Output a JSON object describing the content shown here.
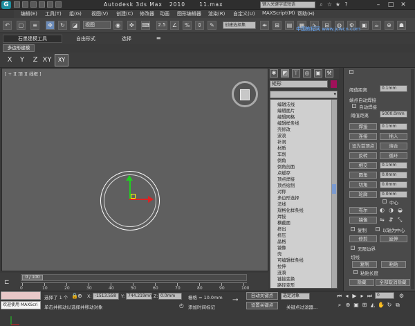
{
  "app": {
    "title": "Autodesk 3ds Max   2010      11.max",
    "search_placeholder": "键入关键字或短语",
    "logo": "3ds-max-logo"
  },
  "menu": [
    "编辑(E)",
    "工具(T)",
    "组(G)",
    "视图(V)",
    "创建(C)",
    "修改器",
    "动画",
    "图形编辑器",
    "渲染(R)",
    "自定义(U)",
    "MAXScript(M)",
    "帮助(H)"
  ],
  "toolbar": {
    "view_dropdown": "视图",
    "angle_snap": "2.5",
    "selection_set": "创建选择集"
  },
  "watermark": "中国教程网 www.jcwcn.com",
  "ribbon": {
    "tabs": [
      "石墨建模工具",
      "自由形式",
      "选择"
    ],
    "subtab": "多边形建模",
    "axes": [
      "X",
      "Y",
      "Z",
      "XY",
      "XY"
    ]
  },
  "viewport": {
    "label": "[ + ][ 顶 ][ 线框 ]"
  },
  "command_panel": {
    "object_name": "矩形",
    "object_color": "#a0105a",
    "modifiers": [
      "编辑法线",
      "编辑面片",
      "编辑网格",
      "编辑样条线",
      "壳修改",
      "波浪",
      "补洞",
      "材质",
      "车削",
      "倒角",
      "倒角剖面",
      "点缓存",
      "顶点焊接",
      "顶点绘制",
      "对称",
      "多边形选择",
      "法线",
      "规格化样条线",
      "焊接",
      "横截面",
      "挤出",
      "挤压",
      "晶格",
      "镜像",
      "壳",
      "可编辑样条线",
      "拉伸",
      "涟漪",
      "链接变换",
      "路径变形"
    ]
  },
  "rollout": {
    "threshold_label": "阈值距离",
    "threshold_value": "0.1mm",
    "auto_weld_group": "端点自动焊接",
    "auto_weld_chk": "自动焊接",
    "auto_weld_value": "5000.0mm",
    "buttons": [
      {
        "name": "weld",
        "label": "焊接",
        "value": "0.1mm"
      },
      {
        "name": "connect",
        "label": "连接",
        "value": "插入"
      },
      {
        "name": "make-first",
        "label": "设为首顶点",
        "value": "熔合"
      },
      {
        "name": "reverse",
        "label": "反转",
        "value": "循环"
      },
      {
        "name": "intersect",
        "label": "相交",
        "value": "0.1mm"
      },
      {
        "name": "fillet",
        "label": "圆角",
        "value": "0.0mm"
      },
      {
        "name": "chamfer",
        "label": "切角",
        "value": "0.0mm"
      },
      {
        "name": "outline",
        "label": "轮廓",
        "value": "0.0mm"
      }
    ],
    "center": "中心",
    "boolean": "布尔",
    "mirror": "镜像",
    "copy": "复制",
    "pivot": "以轴为中心",
    "trim": "修剪",
    "extend": "延伸",
    "infinite": "无限边界",
    "tangent_group": "切线",
    "tan_copy": "复制",
    "tan_paste": "粘贴",
    "paste_length": "粘贴长度",
    "hide": "隐藏",
    "unhide": "全部取消隐藏"
  },
  "timeline": {
    "frame": "0 / 100",
    "ticks": [
      "0",
      "10",
      "20",
      "30",
      "40",
      "50",
      "60",
      "70",
      "80",
      "90",
      "100"
    ]
  },
  "status": {
    "listener_text": "欢迎使用 MAXScri",
    "selected": "选择了 1 个",
    "prompt": "单击并拖动以选择并移动对象",
    "x": "-1513.558",
    "y": "744.219mm",
    "z": "0.0mm",
    "grid": "栅格 = 10.0mm",
    "add_time_tag": "添加时间标记",
    "auto_key": "自动关键点",
    "set_key": "设置关键点",
    "selected_obj": "选定对象",
    "key_filters": "关键点过滤器...",
    "frame_num": "0"
  }
}
